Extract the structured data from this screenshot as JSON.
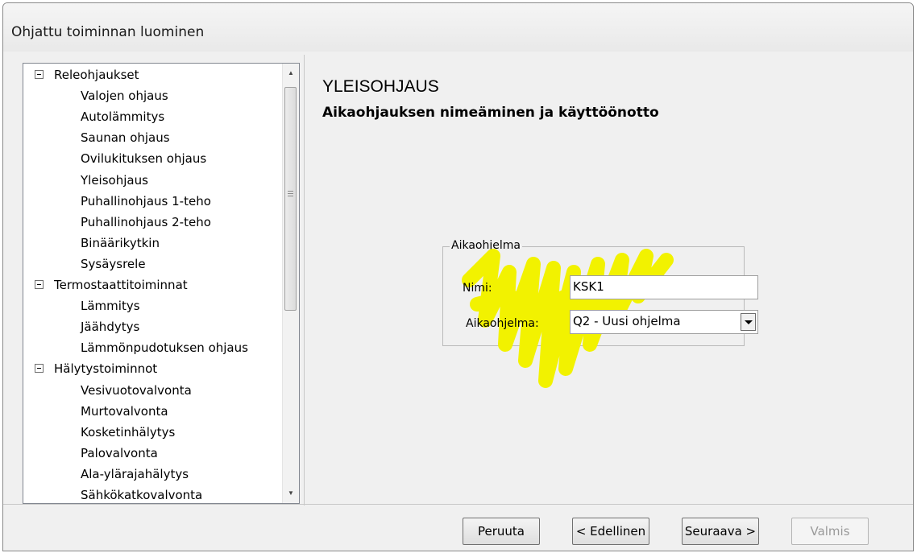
{
  "window": {
    "title": "Ohjattu toiminnan luominen"
  },
  "tree": {
    "groups": [
      {
        "label": "Releohjaukset",
        "children": [
          "Valojen ohjaus",
          "Autolämmitys",
          "Saunan ohjaus",
          "Ovilukituksen ohjaus",
          "Yleisohjaus",
          "Puhallinohjaus 1-teho",
          "Puhallinohjaus 2-teho",
          "Binäärikytkin",
          "Sysäysrele"
        ]
      },
      {
        "label": "Termostaattitoiminnat",
        "children": [
          "Lämmitys",
          "Jäähdytys",
          "Lämmönpudotuksen ohjaus"
        ]
      },
      {
        "label": "Hälytystoiminnot",
        "children": [
          "Vesivuotovalvonta",
          "Murtovalvonta",
          "Kosketinhälytys",
          "Palovalvonta",
          "Ala-ylärajahälytys",
          "Sähkökatkovalvonta"
        ]
      }
    ]
  },
  "main": {
    "heading": "YLEISOHJAUS",
    "subheading": "Aikaohjauksen nimeäminen ja käyttöönotto",
    "groupbox_label": "Aikaohjelma",
    "name_label": "Nimi:",
    "name_value": "KSK1",
    "program_label": "Aikaohjelma:",
    "program_value": "Q2 - Uusi ohjelma",
    "highlight_color": "#f2f200"
  },
  "buttons": {
    "cancel": "Peruuta",
    "previous": "< Edellinen",
    "next": "Seuraava >",
    "finish": "Valmis"
  }
}
